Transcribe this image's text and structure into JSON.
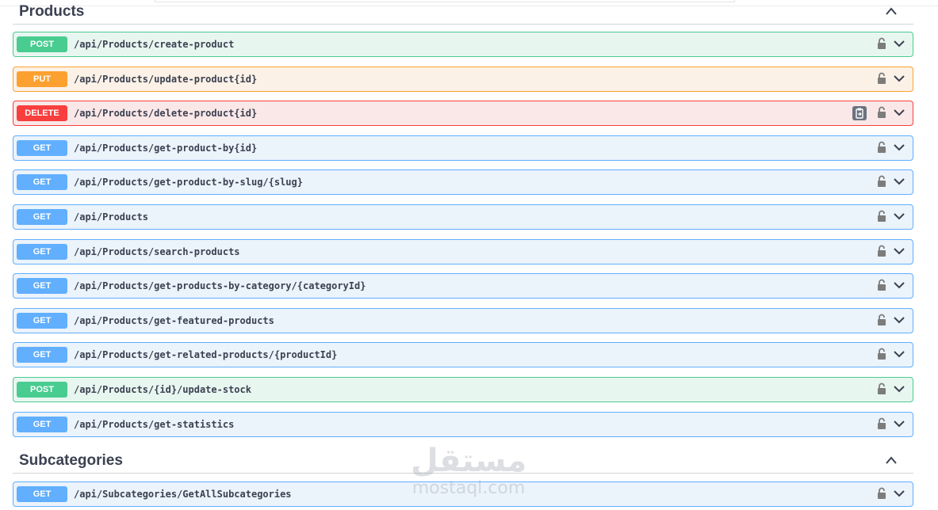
{
  "sections": [
    {
      "title": "Products",
      "operations": [
        {
          "method": "POST",
          "path": "/api/Products/create-product"
        },
        {
          "method": "PUT",
          "path": "/api/Products/update-product{id}"
        },
        {
          "method": "DELETE",
          "path": "/api/Products/delete-product{id}"
        },
        {
          "method": "GET",
          "path": "/api/Products/get-product-by{id}"
        },
        {
          "method": "GET",
          "path": "/api/Products/get-product-by-slug/{slug}"
        },
        {
          "method": "GET",
          "path": "/api/Products"
        },
        {
          "method": "GET",
          "path": "/api/Products/search-products"
        },
        {
          "method": "GET",
          "path": "/api/Products/get-products-by-category/{categoryId}"
        },
        {
          "method": "GET",
          "path": "/api/Products/get-featured-products"
        },
        {
          "method": "GET",
          "path": "/api/Products/get-related-products/{productId}"
        },
        {
          "method": "POST",
          "path": "/api/Products/{id}/update-stock"
        },
        {
          "method": "GET",
          "path": "/api/Products/get-statistics"
        }
      ]
    },
    {
      "title": "Subcategories",
      "operations": [
        {
          "method": "GET",
          "path": "/api/Subcategories/GetAllSubcategories"
        }
      ]
    }
  ],
  "watermark": {
    "arabic": "مستقل",
    "latin": "mostaql.com"
  },
  "icons": {
    "lock": "lock-icon",
    "expand": "chevron-down-icon",
    "collapse": "chevron-up-icon",
    "copy": "clipboard-icon"
  },
  "colors": {
    "post": "#49cc90",
    "put": "#fca130",
    "delete": "#f93e3e",
    "get": "#61affe",
    "text": "#3b4151"
  }
}
